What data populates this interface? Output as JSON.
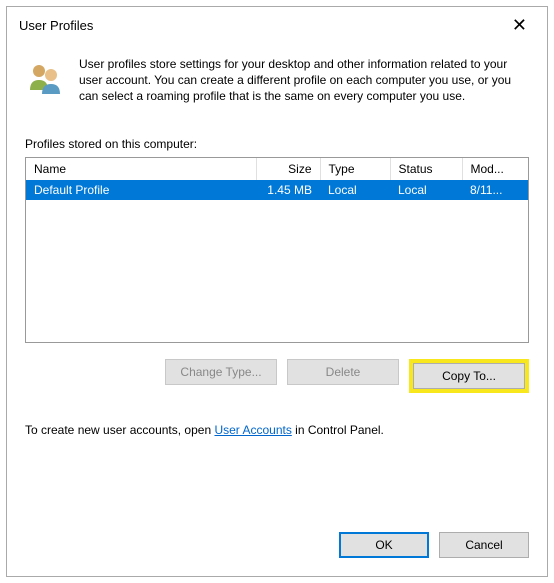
{
  "titlebar": {
    "title": "User Profiles"
  },
  "intro": {
    "text": "User profiles store settings for your desktop and other information related to your user account. You can create a different profile on each computer you use, or you can select a roaming profile that is the same on every computer you use."
  },
  "section": {
    "label": "Profiles stored on this computer:"
  },
  "table": {
    "headers": {
      "name": "Name",
      "size": "Size",
      "type": "Type",
      "status": "Status",
      "mod": "Mod..."
    },
    "rows": [
      {
        "name": "Default Profile",
        "size": "1.45 MB",
        "type": "Local",
        "status": "Local",
        "mod": "8/11..."
      }
    ]
  },
  "buttons": {
    "change_type": "Change Type...",
    "delete": "Delete",
    "copy_to": "Copy To..."
  },
  "footer": {
    "prefix": "To create new user accounts, open ",
    "link": "User Accounts",
    "suffix": " in Control Panel."
  },
  "dialog_buttons": {
    "ok": "OK",
    "cancel": "Cancel"
  }
}
